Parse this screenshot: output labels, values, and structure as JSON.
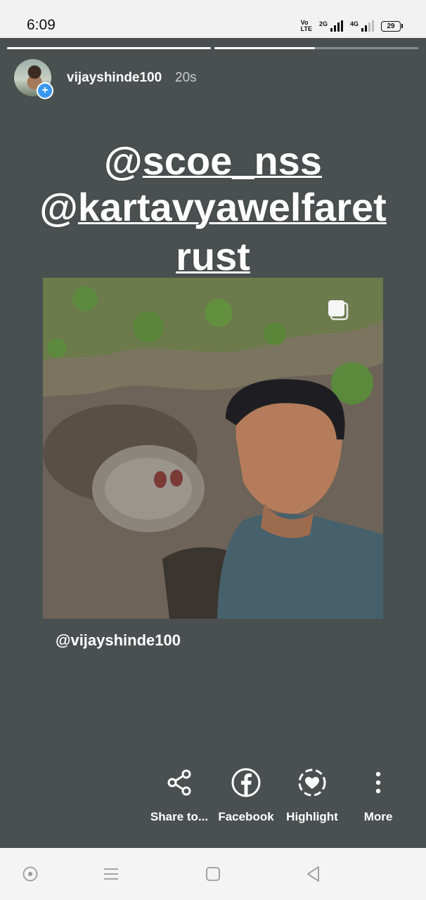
{
  "status_bar": {
    "time": "6:09",
    "network1": "2G",
    "network2": "4G",
    "battery": "29"
  },
  "story": {
    "username": "vijayshinde100",
    "time_ago": "20s",
    "mentions": [
      "@scoe_nss",
      "@kartavyawelfaret",
      "rust"
    ],
    "caption": "@vijayshinde100",
    "progress_segments": 2
  },
  "actions": [
    {
      "label": "Share to...",
      "icon": "share-icon"
    },
    {
      "label": "Facebook",
      "icon": "facebook-icon"
    },
    {
      "label": "Highlight",
      "icon": "highlight-heart-icon"
    },
    {
      "label": "More",
      "icon": "more-dots-icon"
    }
  ],
  "colors": {
    "story_bg": "#4a5050",
    "accent": "#3897f0"
  }
}
